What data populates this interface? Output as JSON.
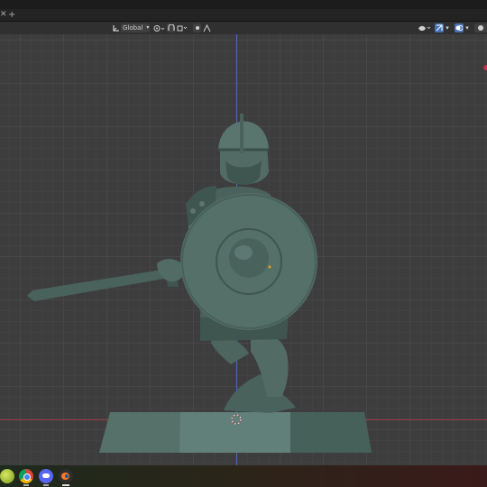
{
  "window": {
    "tab_close_icon": "close-icon",
    "tab_add_label": "+"
  },
  "header": {
    "orientation_label": "Global",
    "orientation_icon": "transform-orientation-icon",
    "pivot_icon": "pivot-point-icon",
    "snap_icon": "snap-icon",
    "proportional_icon": "proportional-editing-icon",
    "visibility_icon": "object-visibility-icon",
    "gizmo_icon": "gizmo-icon",
    "overlay_icon": "overlay-icon",
    "shading_icon": "solid-shading-icon"
  },
  "scene": {
    "subject": "helmeted warrior figure with round shield and sword on rectangular base"
  },
  "taskbar": {
    "apps": [
      "app-launcher-icon",
      "chrome-icon",
      "discord-icon",
      "blender-icon"
    ]
  },
  "colors": {
    "grid_bg": "#3d3d3d",
    "axis_z": "#4a6fb8",
    "axis_x": "#9a3a4a",
    "model": "#4f6660",
    "accent": "#4772b3"
  }
}
